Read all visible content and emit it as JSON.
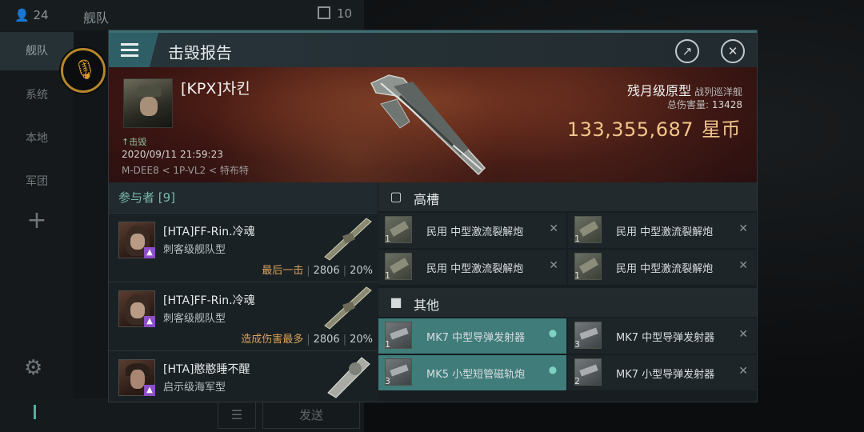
{
  "background": {
    "online_count": "24",
    "panel_title": "舰队",
    "panel_count": "10",
    "sidebar": [
      "舰队",
      "系统",
      "本地",
      "军团"
    ],
    "send_label": "发送"
  },
  "dialog": {
    "title": "击毁报告",
    "pilot_name": "[KPX]차킨",
    "kill_tag": "击毁",
    "datetime": "2020/09/11 21:59:23",
    "location": "M-DEE8 < 1P-VL2 < 特布特",
    "ship_name": "残月级原型",
    "ship_type": "战列巡洋舰",
    "total_damage_label": "总伤害量:",
    "total_damage": "13428",
    "isk_value": "133,355,687",
    "isk_unit": "星币"
  },
  "participants": {
    "header": "参与者 [9]",
    "rows": [
      {
        "name": "[HTA]FF-Rin.冷魂",
        "ship": "刺客级舰队型",
        "label": "最后一击",
        "damage": "2806",
        "percent": "20%"
      },
      {
        "name": "[HTA]FF-Rin.冷魂",
        "ship": "刺客级舰队型",
        "label": "造成伤害最多",
        "damage": "2806",
        "percent": "20%"
      },
      {
        "name": "[HTA]憨憨睡不醒",
        "ship": "启示级海军型",
        "label": "",
        "damage": "",
        "percent": ""
      }
    ]
  },
  "modules": {
    "high_slot_title": "高槽",
    "other_title": "其他",
    "high": [
      {
        "qty": "1",
        "name": "民用 中型激流裂解炮"
      },
      {
        "qty": "1",
        "name": "民用 中型激流裂解炮"
      },
      {
        "qty": "1",
        "name": "民用 中型激流裂解炮"
      },
      {
        "qty": "1",
        "name": "民用 中型激流裂解炮"
      }
    ],
    "other": [
      {
        "qty": "1",
        "name": "MK7 中型导弹发射器"
      },
      {
        "qty": "3",
        "name": "MK7 中型导弹发射器"
      },
      {
        "qty": "3",
        "name": "MK5 小型短管磁轨炮"
      },
      {
        "qty": "2",
        "name": "MK7 小型导弹发射器"
      }
    ]
  },
  "colors": {
    "accent": "#3f7c7a",
    "isk": "#f2c58a",
    "mic": "#d99b2b"
  }
}
